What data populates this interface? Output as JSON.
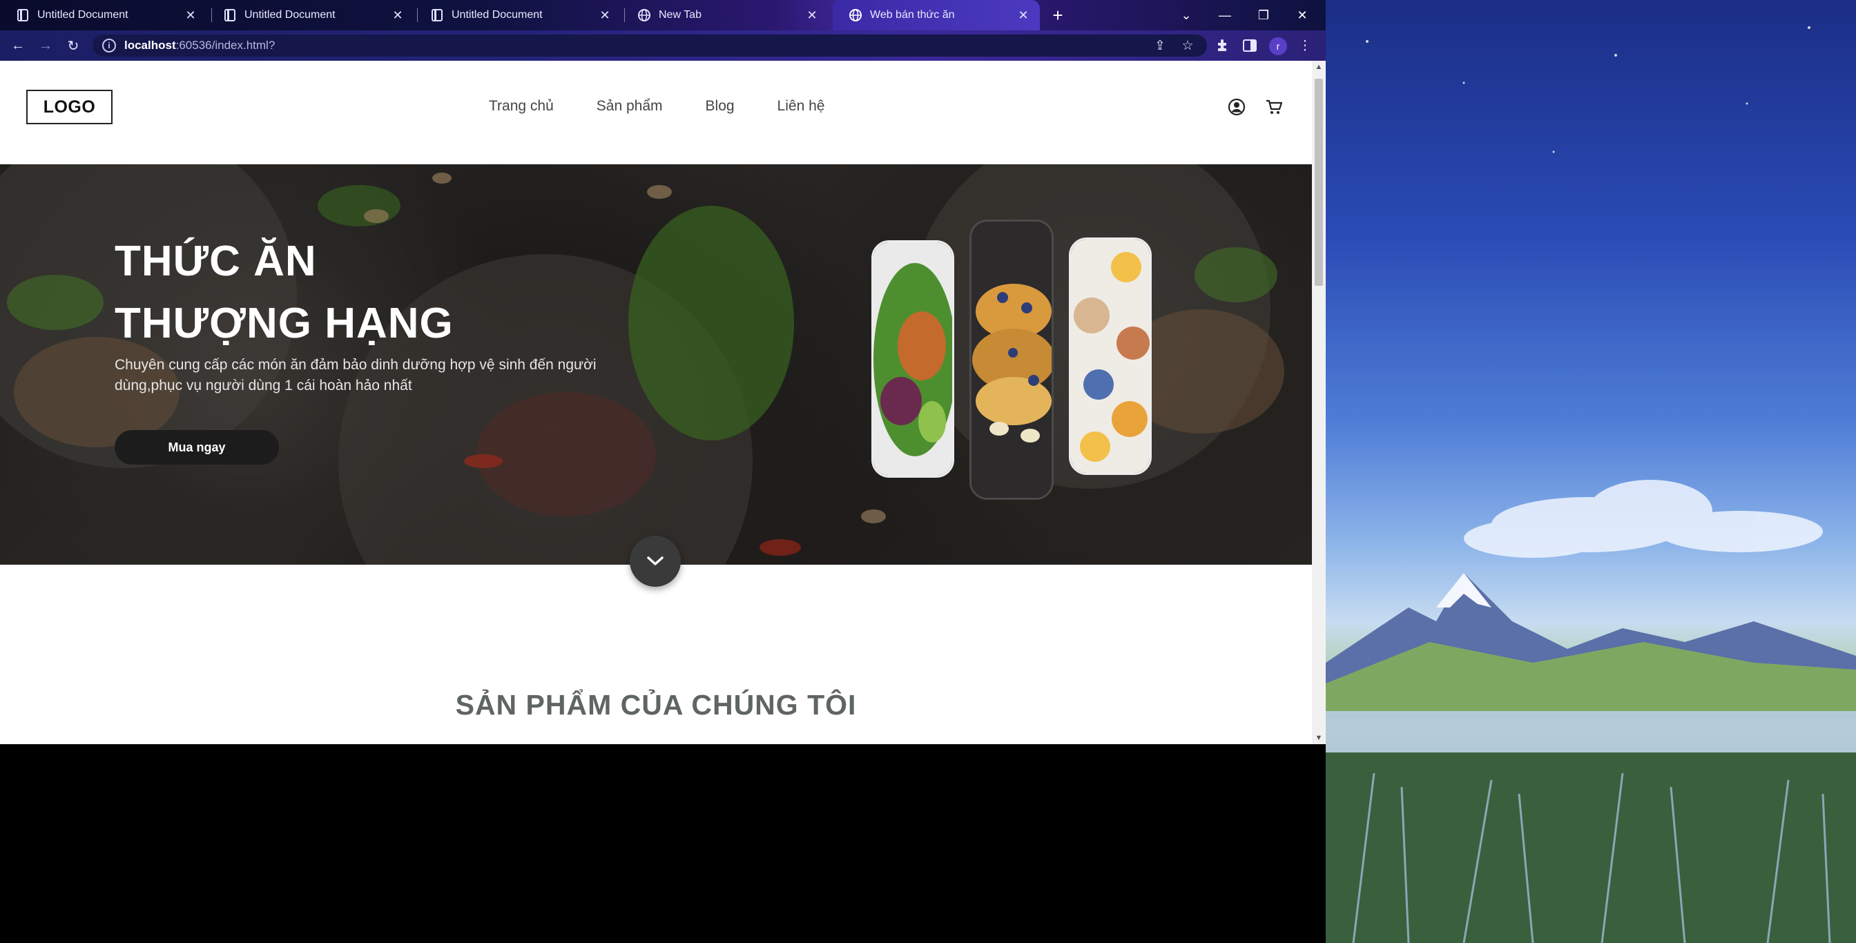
{
  "browser": {
    "tabs": [
      {
        "title": "Untitled Document",
        "active": false
      },
      {
        "title": "Untitled Document",
        "active": false
      },
      {
        "title": "Untitled Document",
        "active": false
      },
      {
        "title": "New Tab",
        "active": false
      },
      {
        "title": "Web bán thức ăn",
        "active": true
      }
    ],
    "url_host": "localhost",
    "url_path": ":60536/index.html?",
    "profile_initial": "r"
  },
  "site": {
    "logo": "LOGO",
    "nav": [
      "Trang chủ",
      "Sản phẩm",
      "Blog",
      "Liên hệ"
    ],
    "hero": {
      "title_line1": "THỨC ĂN",
      "title_line2": "THƯỢNG HẠNG",
      "subtitle": "Chuyên cung cấp các món ăn đảm bảo dinh dưỡng hợp vệ sinh đến người dùng,phục vụ người dùng 1 cái hoàn hảo nhất",
      "cta": "Mua ngay"
    },
    "products_heading": "SẢN PHẨM CỦA CHÚNG TÔI"
  },
  "colors": {
    "accent_tab": "#3b2aa0",
    "button": "#1c1c1c",
    "heading": "#5f6562"
  }
}
